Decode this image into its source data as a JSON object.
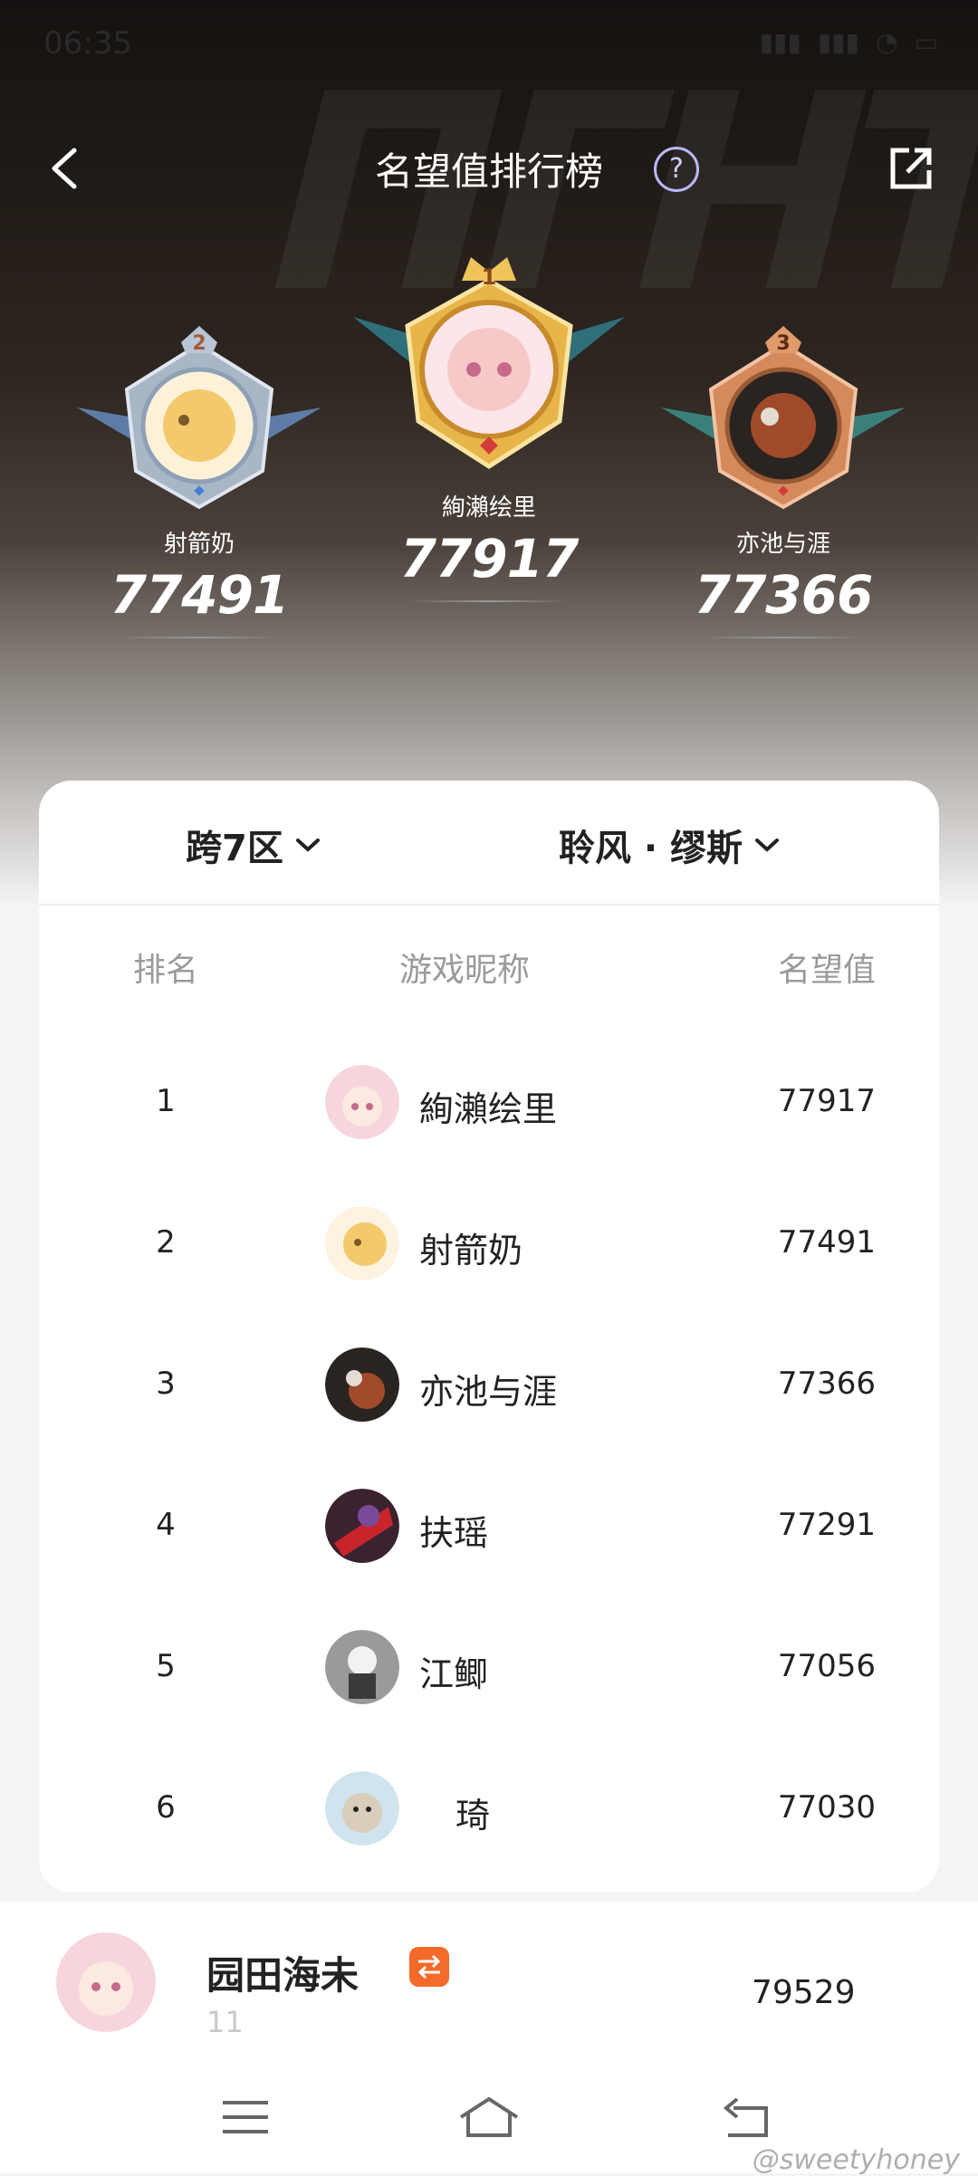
{
  "status_bar": {
    "time": "06:35"
  },
  "header": {
    "title": "名望值排行榜",
    "help_icon": "question-circle-icon",
    "share_icon": "external-link-icon"
  },
  "top3": [
    {
      "rank": "2",
      "name": "射箭奶",
      "score": "77491"
    },
    {
      "rank": "1",
      "name": "絢瀨绘里",
      "score": "77917"
    },
    {
      "rank": "3",
      "name": "亦池与涯",
      "score": "77366"
    }
  ],
  "filters": {
    "region": "跨7区",
    "server": "聆风 · 缪斯"
  },
  "table": {
    "headers": {
      "rank": "排名",
      "name": "游戏昵称",
      "value": "名望值"
    },
    "rows": [
      {
        "rank": "1",
        "name": "絢瀨绘里",
        "value": "77917"
      },
      {
        "rank": "2",
        "name": "射箭奶",
        "value": "77491"
      },
      {
        "rank": "3",
        "name": "亦池与涯",
        "value": "77366"
      },
      {
        "rank": "4",
        "name": "扶瑶",
        "value": "77291"
      },
      {
        "rank": "5",
        "name": "江鲫",
        "value": "77056"
      },
      {
        "rank": "6",
        "name": "琦",
        "value": "77030"
      }
    ]
  },
  "self": {
    "name": "园田海未",
    "rank": "11",
    "value": "79529"
  },
  "watermark": "@sweetyhoney",
  "colors": {
    "gold": "#e8b54a",
    "silver": "#a9b6c6",
    "bronze": "#d58a5c",
    "accent_orange": "#f26b2b"
  }
}
